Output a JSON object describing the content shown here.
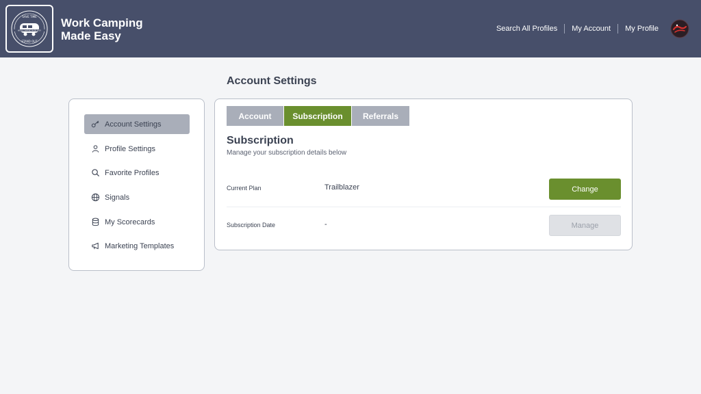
{
  "header": {
    "logo": {
      "alt": "Work Camping Made Easy logo",
      "top_text": "SAVE TIME",
      "band_text": "WORK CAMPING MADE EASY",
      "bottom_text": "STAND OUT"
    },
    "brand_line1": "Work Camping",
    "brand_line2": "Made Easy",
    "nav": [
      {
        "label": "Search All Profiles"
      },
      {
        "label": "My Account"
      },
      {
        "label": "My Profile"
      }
    ],
    "profile_badge_icon": "circular-logo-badge-icon",
    "bg_color": "#474f6a"
  },
  "page_title": "Account Settings",
  "sidebar": {
    "items": [
      {
        "label": "Account Settings",
        "icon": "key-icon",
        "active": true
      },
      {
        "label": "Profile Settings",
        "icon": "user-icon",
        "active": false
      },
      {
        "label": "Favorite Profiles",
        "icon": "search-icon",
        "active": false
      },
      {
        "label": "Signals",
        "icon": "globe-icon",
        "active": false
      },
      {
        "label": "My Scorecards",
        "icon": "database-icon",
        "active": false
      },
      {
        "label": "Marketing Templates",
        "icon": "megaphone-icon",
        "active": false
      }
    ]
  },
  "tabs": [
    {
      "label": "Account",
      "active": false
    },
    {
      "label": "Subscription",
      "active": true
    },
    {
      "label": "Referrals",
      "active": false
    }
  ],
  "subscription": {
    "title": "Subscription",
    "description": "Manage your subscription details below",
    "current_plan_label": "Current Plan",
    "current_plan_value": "Trailblazer",
    "change_button": "Change",
    "subscription_date_label": "Subscription Date",
    "subscription_date_value": "-",
    "manage_button": "Manage"
  },
  "colors": {
    "accent_green": "#6a8f2e",
    "inactive_tab": "#a9aeb9",
    "disabled_button": "#dfe1e5"
  }
}
